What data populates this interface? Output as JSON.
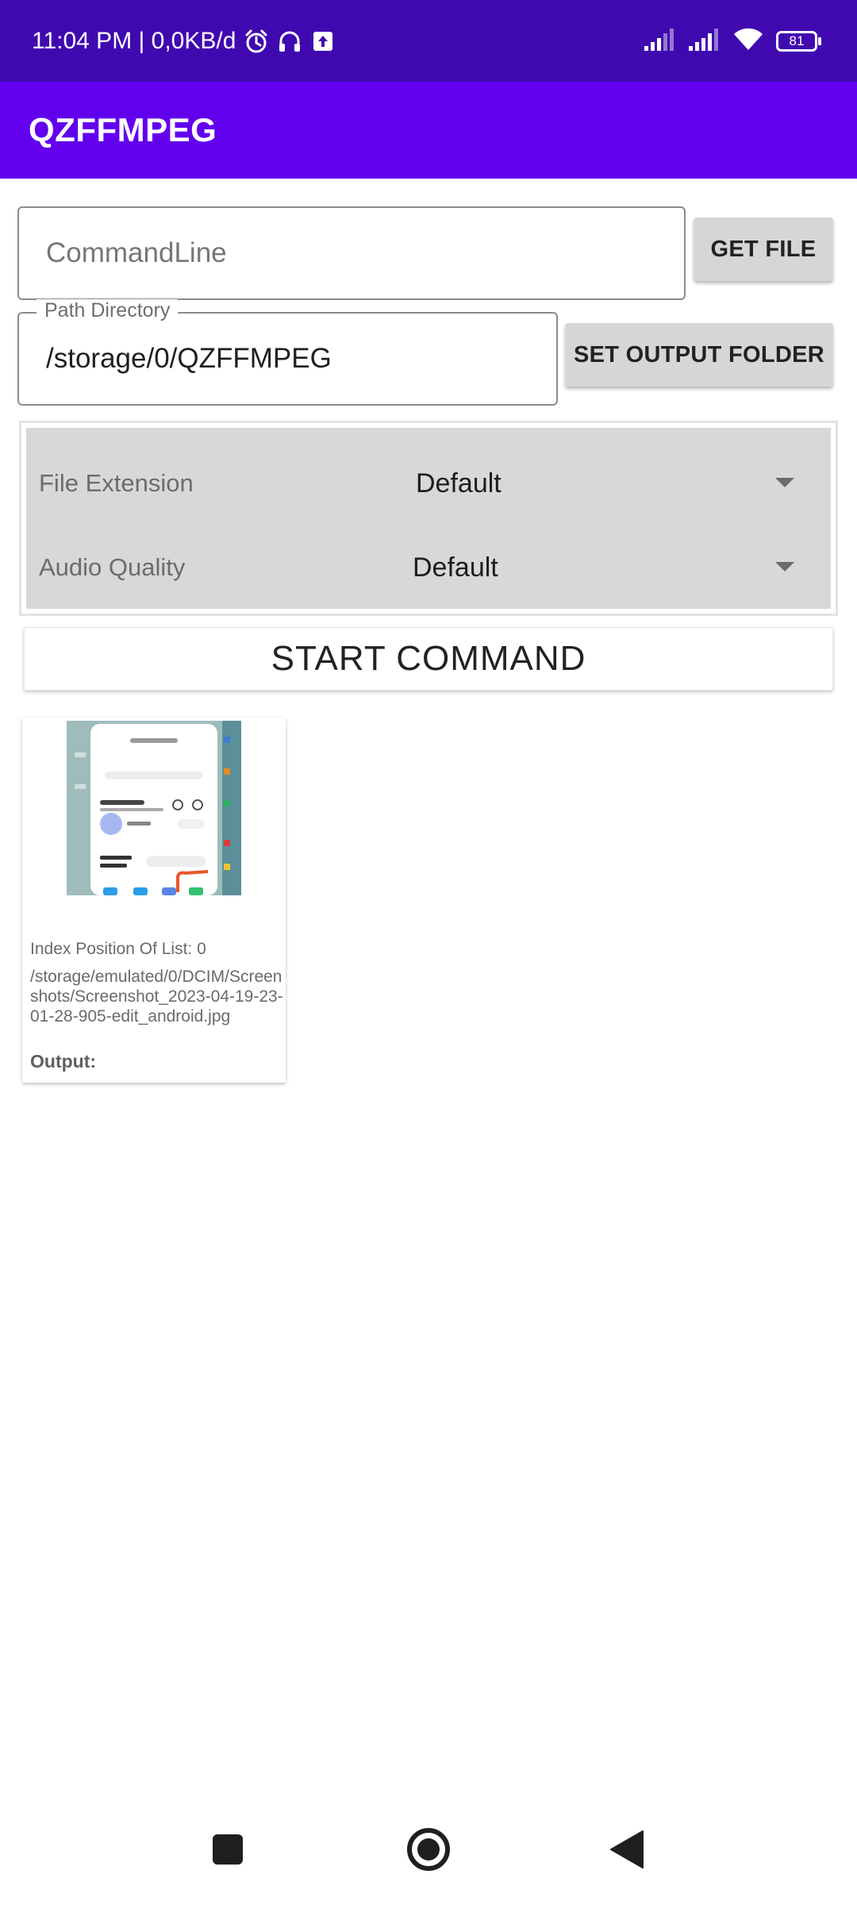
{
  "status_bar": {
    "time_info": "11:04 PM | 0,0KB/d",
    "battery_level": "81",
    "icons": [
      "alarm-icon",
      "headphones-icon",
      "upload-icon",
      "signal-icon",
      "signal-icon",
      "wifi-icon",
      "battery-icon"
    ]
  },
  "app_bar": {
    "title": "QZFFMPEG",
    "color": "#6200ee",
    "status_color": "#4009b0"
  },
  "command_line": {
    "placeholder": "CommandLine",
    "value": ""
  },
  "get_file_button": {
    "label": "GET FILE"
  },
  "path_directory": {
    "label": "Path Directory",
    "value": "/storage/0/QZFFMPEG"
  },
  "set_output_button": {
    "label": "SET OUTPUT FOLDER"
  },
  "options": {
    "file_extension": {
      "label": "File Extension",
      "value": "Default"
    },
    "audio_quality": {
      "label": "Audio Quality",
      "value": "Default"
    }
  },
  "start_button": {
    "label": "START COMMAND"
  },
  "list": {
    "items": [
      {
        "index_text": "Index Position Of List: 0",
        "path": "/storage/emulated/0/DCIM/Screenshots/Screenshot_2023-04-19-23-01-28-905-edit_android.jpg",
        "output_label": "Output:"
      }
    ]
  },
  "nav_bar": {
    "icons": [
      "recents-icon",
      "home-icon",
      "back-icon"
    ]
  }
}
